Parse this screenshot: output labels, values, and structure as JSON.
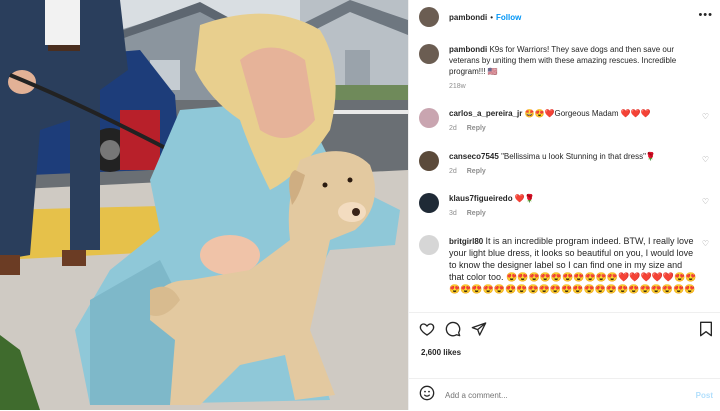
{
  "post": {
    "username": "pambondi",
    "follow_label": "Follow",
    "caption_user": "pambondi",
    "caption_text": "K9s for Warriors! They save dogs and then save our veterans by uniting them with these amazing rescues. Incredible program!!! 🇺🇸",
    "caption_time": "218w"
  },
  "comments": [
    {
      "user": "carlos_a_pereira_jr",
      "text": "🤩😍❤️Gorgeous Madam ❤️❤️❤️",
      "time": "2d",
      "reply_label": "Reply"
    },
    {
      "user": "canseco7545",
      "text": "\"Bellissima u look Stunning in that dress\"🌹",
      "time": "2d",
      "reply_label": "Reply"
    },
    {
      "user": "klaus7figueiredo",
      "text": "❤️🌹",
      "time": "3d",
      "reply_label": "Reply"
    },
    {
      "user": "britgirl80",
      "text": "It is an incredible program indeed. BTW, I really love your light blue dress, it looks so beautiful on you, I would love to know the designer label so I can find one in my size and that color too. 😍😍😍😍😍😍😍😍😍😍❤️❤️❤️❤️❤️😍😍😍😍😍😍😍😍😍😍😍😍😍😍😍😍😍😍😍😍😍😍😍😍",
      "time": "",
      "reply_label": ""
    }
  ],
  "likes": "2,600 likes",
  "add_comment_placeholder": "Add a comment...",
  "post_button": "Post",
  "colors": {
    "link": "#0095f6",
    "muted": "#8e8e8e",
    "dress": "#8fc8d8",
    "suit": "#2a3e5c"
  }
}
